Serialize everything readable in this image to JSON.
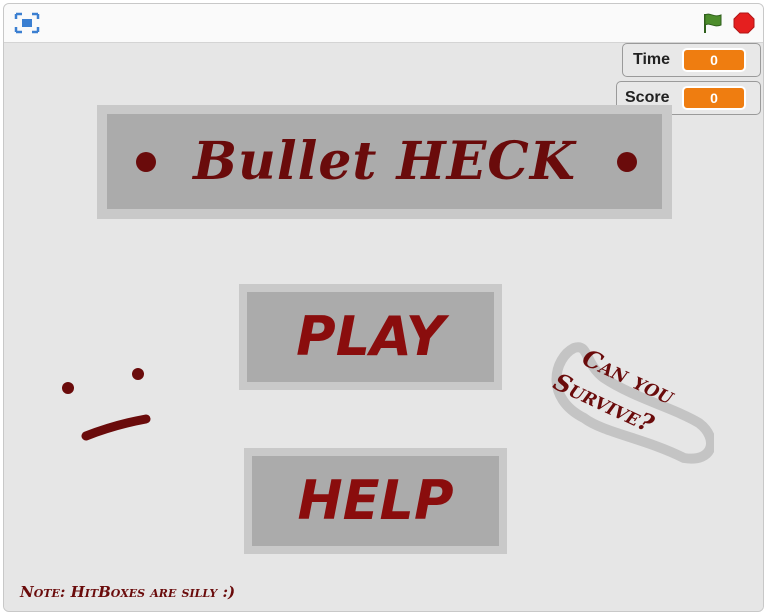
{
  "toolbar": {
    "fullscreen_icon": "fullscreen-icon",
    "flag_icon": "green-flag-icon",
    "stop_icon": "stop-sign-icon"
  },
  "monitors": [
    {
      "label": "Time",
      "value": "0"
    },
    {
      "label": "Score",
      "value": "0"
    }
  ],
  "game": {
    "title": "Bullet HECK",
    "play_label": "PLAY",
    "help_label": "HELP",
    "taunt_line1": "Can you",
    "taunt_line2": "Survive?",
    "note": "Note: HitBoxes are silly :)"
  },
  "colors": {
    "dark_red": "#6a0b0b",
    "button_red": "#8a0d0d",
    "monitor_orange": "#ef7d10",
    "stage_bg": "#e6e6e6",
    "panel_gray": "#ababab",
    "panel_border": "#c9c9c9",
    "flag_green": "#4c8c2b",
    "stop_red": "#e51f1f"
  }
}
